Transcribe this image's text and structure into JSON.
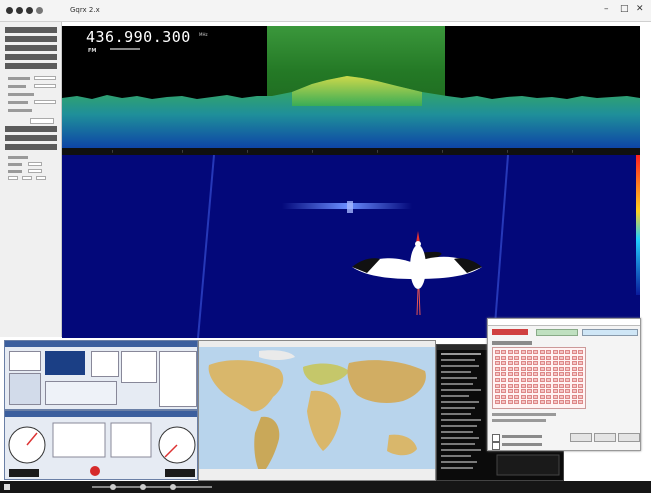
{
  "window": {
    "title": "Gqrx 2.x",
    "minimize_glyph": "–",
    "maximize_glyph": "□",
    "close_glyph": "✕"
  },
  "receiver": {
    "frequency": "436.990.300",
    "frequency_unit": "MHz",
    "mode": "FM"
  },
  "colors": {
    "spectrum_bg": "#000000",
    "filter_green": "#3fa640",
    "waterfall_bg": "#03087a",
    "signal_blue": "#4d6dff",
    "map_ocean": "#b8d4ec",
    "map_land": "#d9b76b",
    "terminal_bg": "#0b0b0b",
    "dialog_grid": "#f3c4c4"
  },
  "icons": {
    "waterfall_overlay": "stork-icon"
  }
}
